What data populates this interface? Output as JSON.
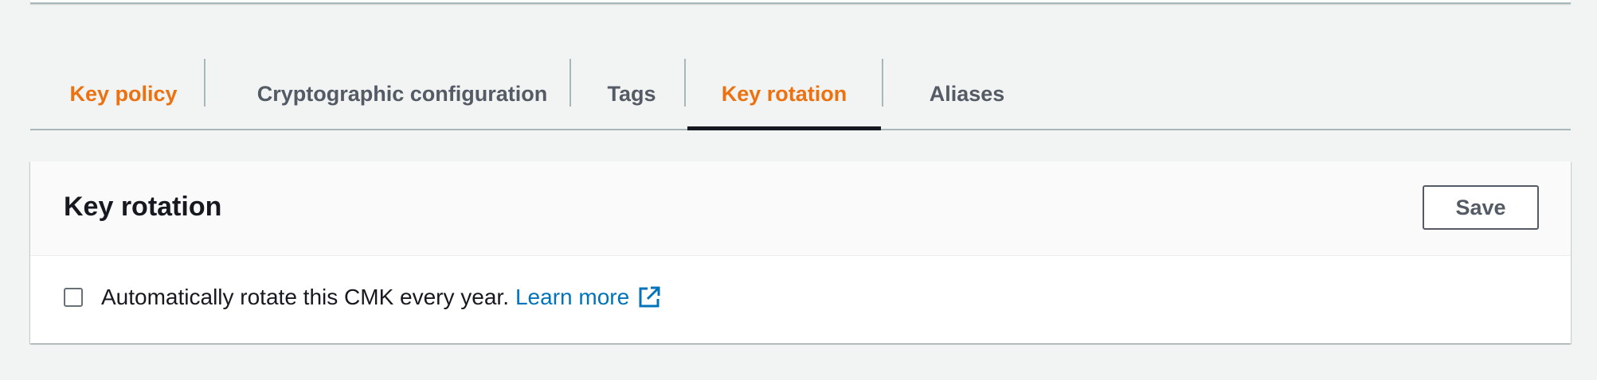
{
  "tabs": [
    {
      "label": "Key policy",
      "style": "orange",
      "active": false
    },
    {
      "label": "Cryptographic configuration",
      "style": "gray",
      "active": false
    },
    {
      "label": "Tags",
      "style": "gray",
      "active": false
    },
    {
      "label": "Key rotation",
      "style": "orange",
      "active": true
    },
    {
      "label": "Aliases",
      "style": "gray",
      "active": false
    }
  ],
  "panel": {
    "title": "Key rotation",
    "save_label": "Save",
    "checkbox": {
      "checked": false,
      "label": "Automatically rotate this CMK every year.",
      "link_text": "Learn more",
      "link_icon": "external-link-icon"
    }
  },
  "colors": {
    "accent_orange": "#ec7211",
    "link_blue": "#0073bb",
    "tab_text": "#545b64",
    "active_underline": "#16191f",
    "background": "#f2f3f3"
  }
}
